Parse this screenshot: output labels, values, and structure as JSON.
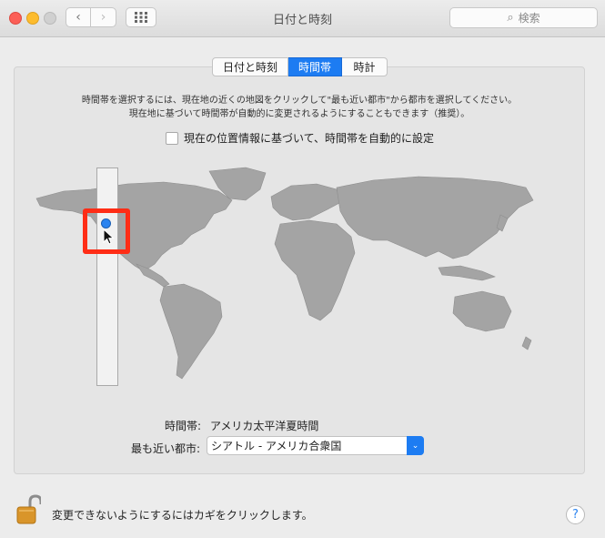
{
  "window": {
    "title": "日付と時刻"
  },
  "toolbar": {
    "back_icon": "‹",
    "forward_icon": "›",
    "grid_icon": "⋮⋮⋮",
    "search_placeholder": "検索"
  },
  "tabs": [
    {
      "label": "日付と時刻",
      "selected": false
    },
    {
      "label": "時間帯",
      "selected": true
    },
    {
      "label": "時計",
      "selected": false
    }
  ],
  "description": {
    "line1": "時間帯を選択するには、現在地の近くの地図をクリックして\"最も近い都市\"から都市を選択してください。",
    "line2": "現在地に基づいて時間帯が自動的に変更されるようにすることもできます（推奨）。"
  },
  "auto_timezone": {
    "label": "現在の位置情報に基づいて、時間帯を自動的に設定",
    "checked": false
  },
  "timezone": {
    "label": "時間帯:",
    "value": "アメリカ太平洋夏時間"
  },
  "closest_city": {
    "label": "最も近い都市:",
    "value": "シアトル - アメリカ合衆国"
  },
  "footer": {
    "lock_text": "変更できないようにするにはカギをクリックします。",
    "help": "?"
  },
  "colors": {
    "accent": "#1d7cf2",
    "highlight": "#ff2d16",
    "land": "#a4a4a4"
  }
}
